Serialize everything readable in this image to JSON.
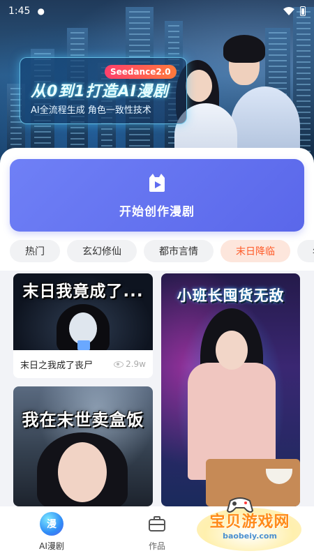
{
  "status_bar": {
    "time": "1:45"
  },
  "banner": {
    "badge": "Seedance2.0",
    "title": "从0到1打造AI漫剧",
    "subtitle": "AI全流程生成 角色一致性技术"
  },
  "create_button": {
    "label": "开始创作漫剧"
  },
  "categories": {
    "items": [
      "热门",
      "玄幻修仙",
      "都市言情",
      "末日降临",
      "年代"
    ],
    "active_index": 3,
    "active_color": "#ff5a27"
  },
  "feed": {
    "cards": [
      {
        "thumb_title": "末日我竟成了...",
        "name": "末日之我成了丧尸",
        "views": "2.9w"
      },
      {
        "thumb_title": "小班长囤货无敌"
      },
      {
        "thumb_title": "我在末世卖盒饭"
      }
    ]
  },
  "bottom_nav": {
    "items": [
      {
        "label": "AI漫剧",
        "icon_text": "漫",
        "icon": "comic-icon"
      },
      {
        "label": "作品",
        "icon": "briefcase-icon"
      }
    ]
  },
  "watermark": {
    "text": "宝贝游戏网",
    "url": "baobeiy.com"
  },
  "colors": {
    "primary": "#5a67ea",
    "accent": "#ff5a27"
  }
}
